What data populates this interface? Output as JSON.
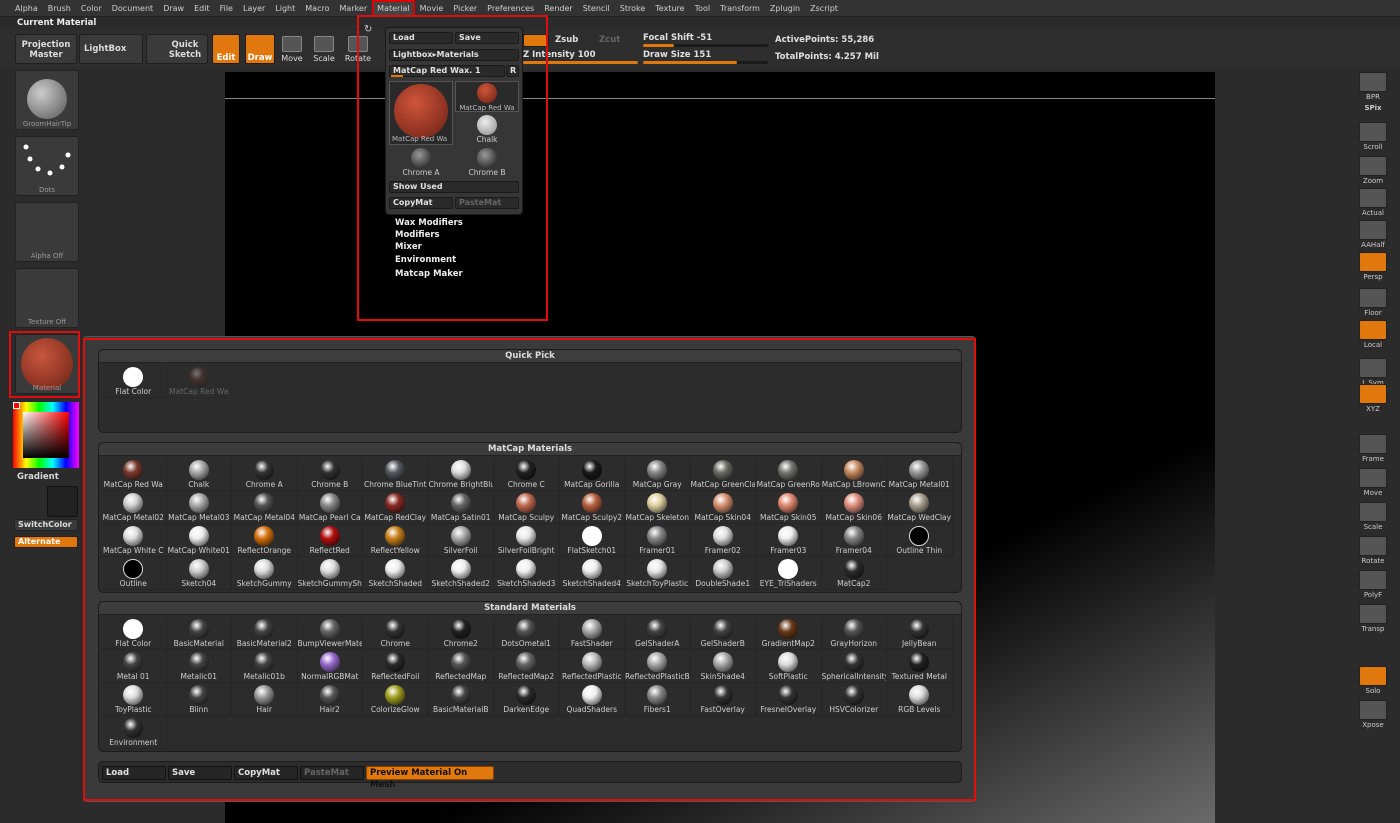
{
  "menu": [
    "Alpha",
    "Brush",
    "Color",
    "Document",
    "Draw",
    "Edit",
    "File",
    "Layer",
    "Light",
    "Macro",
    "Marker",
    "Material",
    "Movie",
    "Picker",
    "Preferences",
    "Render",
    "Stencil",
    "Stroke",
    "Texture",
    "Tool",
    "Transform",
    "Zplugin",
    "Zscript"
  ],
  "current_material_title": "Current Material",
  "toolbar": {
    "projection_master": "Projection\nMaster",
    "lightbox": "LightBox",
    "quick_sketch": "Quick\nSketch",
    "edit": "Edit",
    "draw": "Draw",
    "move": "Move",
    "scale": "Scale",
    "rotate": "Rotate",
    "zsub": "Zsub",
    "zcut": "Zcut",
    "z_intensity": "Z Intensity 100",
    "focal_shift": "Focal Shift -51",
    "draw_size": "Draw Size 151",
    "active_points": "ActivePoints: 55,286",
    "total_points": "TotalPoints: 4.257 Mil"
  },
  "left": {
    "brush_thumb": "GroomHairTip",
    "stroke_thumb": "Dots",
    "alpha_thumb": "Alpha  Off",
    "texture_thumb": "Texture  Off",
    "material_thumb": "Material",
    "gradient": "Gradient",
    "switch_color": "SwitchColor",
    "alternate": "Alternate"
  },
  "dropdown": {
    "load": "Load",
    "save": "Save",
    "lightbox_materials": "Lightbox▸Materials",
    "current": "MatCap  Red  Wax. 1",
    "r": "R",
    "items": [
      {
        "name": "MatCap  Red  Wa",
        "color": "#b3432d"
      },
      {
        "name": "MatCap  Red  Wa",
        "color": "#b3432d"
      },
      {
        "name": "Chalk",
        "color": "#bdbdbd"
      },
      {
        "name": "Chrome  A",
        "color": "#2a2a2a"
      },
      {
        "name": "Chrome  B",
        "color": "#2a2a2a"
      }
    ],
    "show_used": "Show  Used",
    "copymat": "CopyMat",
    "pastemat": "PasteMat",
    "submenus": [
      "Wax  Modifiers",
      "Modifiers",
      "Mixer",
      "Environment",
      "Matcap  Maker"
    ]
  },
  "right": [
    "BPR",
    "SPix",
    "Scroll",
    "Zoom",
    "Actual",
    "AAHalf",
    "Persp",
    "Floor",
    "Local",
    "L.Sym",
    "XYZ",
    "Frame",
    "Move",
    "Scale",
    "Rotate",
    "PolyF",
    "Transp",
    "Solo",
    "Xpose"
  ],
  "palette": {
    "quick_pick_title": "Quick  Pick",
    "quick_pick": [
      {
        "name": "Flat  Color",
        "color": "#ffffff"
      },
      {
        "name": "MatCap  Red  Wa",
        "color": "#6a3a30",
        "dim": true
      }
    ],
    "matcap_title": "MatCap  Materials",
    "matcap": [
      {
        "name": "MatCap  Red  Wa",
        "color": "#7a3a2e"
      },
      {
        "name": "Chalk",
        "color": "#aaaaaa"
      },
      {
        "name": "Chrome  A",
        "color": "#333333"
      },
      {
        "name": "Chrome  B",
        "color": "#333333"
      },
      {
        "name": "Chrome  BlueTint",
        "color": "#555a60"
      },
      {
        "name": "Chrome  BrightBlu",
        "color": "#dddddd"
      },
      {
        "name": "Chrome  C",
        "color": "#222222"
      },
      {
        "name": "MatCap  Gorilla",
        "color": "#1a1a1a"
      },
      {
        "name": "MatCap  Gray",
        "color": "#888888"
      },
      {
        "name": "MatCap  GreenCla",
        "color": "#6c6c66"
      },
      {
        "name": "MatCap  GreenRo",
        "color": "#777770"
      },
      {
        "name": "MatCap  LBrownC",
        "color": "#c58a60"
      },
      {
        "name": "MatCap  Metal01",
        "color": "#9a9a9a"
      },
      {
        "name": "MatCap  Metal02",
        "color": "#d0d0d0"
      },
      {
        "name": "MatCap  Metal03",
        "color": "#aaaaaa"
      },
      {
        "name": "MatCap  Metal04",
        "color": "#555555"
      },
      {
        "name": "MatCap  Pearl  Ca",
        "color": "#8a8a8a"
      },
      {
        "name": "MatCap  RedClay",
        "color": "#8a2a24"
      },
      {
        "name": "MatCap  Satin01",
        "color": "#666666"
      },
      {
        "name": "MatCap  Sculpy",
        "color": "#c06a50"
      },
      {
        "name": "MatCap  Sculpy2",
        "color": "#b86040"
      },
      {
        "name": "MatCap  Skeleton",
        "color": "#e0d0a0"
      },
      {
        "name": "MatCap  Skin04",
        "color": "#d69070"
      },
      {
        "name": "MatCap  Skin05",
        "color": "#e08870"
      },
      {
        "name": "MatCap  Skin06",
        "color": "#e09080"
      },
      {
        "name": "MatCap  WedClay",
        "color": "#aaa090"
      },
      {
        "name": "MatCap  White  C",
        "color": "#dddddd"
      },
      {
        "name": "MatCap  White01",
        "color": "#eeeeee"
      },
      {
        "name": "ReflectOrange",
        "color": "#d4700f"
      },
      {
        "name": "ReflectRed",
        "color": "#b01010"
      },
      {
        "name": "ReflectYellow",
        "color": "#c8801a"
      },
      {
        "name": "SilverFoil",
        "color": "#aaaaaa"
      },
      {
        "name": "SilverFoilBright",
        "color": "#e8e8e8"
      },
      {
        "name": "FlatSketch01",
        "color": "#ffffff"
      },
      {
        "name": "Framer01",
        "color": "#888888"
      },
      {
        "name": "Framer02",
        "color": "#dddddd"
      },
      {
        "name": "Framer03",
        "color": "#eeeeee"
      },
      {
        "name": "Framer04",
        "color": "#888888"
      },
      {
        "name": "Outline  Thin",
        "color": "#000000"
      },
      {
        "name": "Outline",
        "color": "#000000"
      },
      {
        "name": "Sketch04",
        "color": "#cccccc"
      },
      {
        "name": "SketchGummy",
        "color": "#dddddd"
      },
      {
        "name": "SketchGummyShi",
        "color": "#dddddd"
      },
      {
        "name": "SketchShaded",
        "color": "#eeeeee"
      },
      {
        "name": "SketchShaded2",
        "color": "#eeeeee"
      },
      {
        "name": "SketchShaded3",
        "color": "#eeeeee"
      },
      {
        "name": "SketchShaded4",
        "color": "#eeeeee"
      },
      {
        "name": "SketchToyPlastic",
        "color": "#e8e8e8"
      },
      {
        "name": "DoubleShade1",
        "color": "#cccccc"
      },
      {
        "name": "EYE_TriShaders",
        "color": "#ffffff"
      },
      {
        "name": "MatCap2",
        "color": "#2c2c2c"
      }
    ],
    "standard_title": "Standard  Materials",
    "standard": [
      {
        "name": "Flat  Color",
        "color": "#ffffff"
      },
      {
        "name": "BasicMaterial",
        "color": "#444444"
      },
      {
        "name": "BasicMaterial2",
        "color": "#444444"
      },
      {
        "name": "BumpViewerMate",
        "color": "#666666"
      },
      {
        "name": "Chrome",
        "color": "#333333"
      },
      {
        "name": "Chrome2",
        "color": "#222222"
      },
      {
        "name": "DotsOmetal1",
        "color": "#555555"
      },
      {
        "name": "FastShader",
        "color": "#aaaaaa"
      },
      {
        "name": "GelShaderA",
        "color": "#444444"
      },
      {
        "name": "GelShaderB",
        "color": "#444444"
      },
      {
        "name": "GradientMap2",
        "color": "#6a3a1a"
      },
      {
        "name": "GrayHorizon",
        "color": "#555555"
      },
      {
        "name": "JellyBean",
        "color": "#333333"
      },
      {
        "name": "Metal  01",
        "color": "#444444"
      },
      {
        "name": "Metalic01",
        "color": "#444444"
      },
      {
        "name": "Metalic01b",
        "color": "#444444"
      },
      {
        "name": "NormalRGBMat",
        "color": "#9a6ad0"
      },
      {
        "name": "ReflectedFoil",
        "color": "#2a2a2a"
      },
      {
        "name": "ReflectedMap",
        "color": "#555555"
      },
      {
        "name": "ReflectedMap2",
        "color": "#666666"
      },
      {
        "name": "ReflectedPlastic",
        "color": "#bbbbbb"
      },
      {
        "name": "ReflectedPlasticB",
        "color": "#aaaaaa"
      },
      {
        "name": "SkinShade4",
        "color": "#aaaaaa"
      },
      {
        "name": "SoftPlastic",
        "color": "#dddddd"
      },
      {
        "name": "SphericalIntensity",
        "color": "#333333"
      },
      {
        "name": "Textured  Metal",
        "color": "#222222"
      },
      {
        "name": "ToyPlastic",
        "color": "#dddddd"
      },
      {
        "name": "Blinn",
        "color": "#444444"
      },
      {
        "name": "Hair",
        "color": "#999999"
      },
      {
        "name": "Hair2",
        "color": "#555555"
      },
      {
        "name": "ColorizeGlow",
        "color": "#a0a020"
      },
      {
        "name": "BasicMaterialB",
        "color": "#444444"
      },
      {
        "name": "DarkenEdge",
        "color": "#2a2a2a"
      },
      {
        "name": "QuadShaders",
        "color": "#eeeeee"
      },
      {
        "name": "Fibers1",
        "color": "#888888"
      },
      {
        "name": "FastOverlay",
        "color": "#333333"
      },
      {
        "name": "FresnelOverlay",
        "color": "#333333"
      },
      {
        "name": "HSVColorizer",
        "color": "#333333"
      },
      {
        "name": "RGB  Levels",
        "color": "#dddddd"
      },
      {
        "name": "Environment",
        "color": "#333333"
      }
    ],
    "bottom": {
      "load": "Load",
      "save": "Save",
      "copymat": "CopyMat",
      "pastemat": "PasteMat",
      "preview": "Preview  Material  On  Mesh"
    }
  },
  "colors": {
    "accent": "#e0780e",
    "highlight": "#e10d0d",
    "canvas": "#000000"
  }
}
